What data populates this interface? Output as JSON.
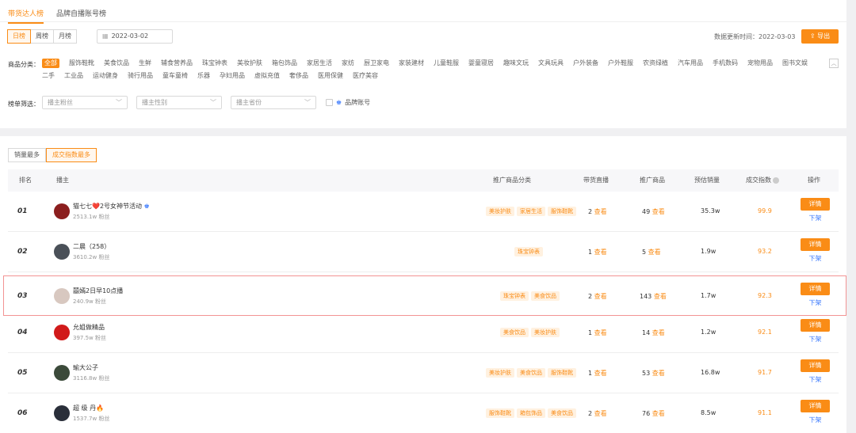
{
  "top_tabs": [
    {
      "label": "带货达人榜",
      "active": true
    },
    {
      "label": "品牌自播账号榜",
      "active": false
    }
  ],
  "period_buttons": [
    {
      "label": "日榜",
      "active": true
    },
    {
      "label": "周榜",
      "active": false
    },
    {
      "label": "月榜",
      "active": false
    }
  ],
  "date_picker": {
    "value": "2022-03-02",
    "icon": "calendar-icon"
  },
  "update_time": "数据更新时间：2022-03-03",
  "export_button": {
    "label": "导出",
    "icon": "upload-icon"
  },
  "categories": {
    "label": "商品分类：",
    "items": [
      "全部",
      "服饰鞋靴",
      "美食饮品",
      "生鲜",
      "辅食营养品",
      "珠宝钟表",
      "美妆护肤",
      "箱包饰品",
      "家居生活",
      "家纺",
      "厨卫家电",
      "家装建材",
      "儿童鞋服",
      "婴童寝居",
      "趣味文玩",
      "文具玩具",
      "户外装备",
      "户外鞋服",
      "农资绿植",
      "汽车用品",
      "手机数码",
      "宠物用品",
      "图书文娱",
      "二手",
      "工业品",
      "运动健身",
      "骑行用品",
      "童车童椅",
      "乐器",
      "孕妇用品",
      "虚拟充值",
      "奢侈品",
      "医用保健",
      "医疗美容"
    ],
    "active_index": 0,
    "toggle_icon": "chevron-up-icon"
  },
  "filters": {
    "label": "榜单筛选：",
    "selects": [
      {
        "placeholder": "播主粉丝"
      },
      {
        "placeholder": "播主性别"
      },
      {
        "placeholder": "播主省份"
      }
    ],
    "brand_checkbox": {
      "label": "品牌账号",
      "checked": false
    }
  },
  "sort_buttons": [
    {
      "label": "销量最多",
      "active": false
    },
    {
      "label": "成交指数最多",
      "active": true
    }
  ],
  "table": {
    "headers": {
      "rank": "排名",
      "host": "播主",
      "categories": "推广商品分类",
      "live": "带货直播",
      "products": "推广商品",
      "sales": "预估销量",
      "index": "成交指数",
      "actions": "操作"
    },
    "view_label": "查看",
    "detail_label": "详情",
    "offshelf_label": "下架",
    "rows": [
      {
        "rank": "01",
        "name": "猫七七❤️2号女神节活动",
        "fans": "2513.1w 粉丝",
        "tags": [
          "美妆护肤",
          "家居生活",
          "服饰鞋靴"
        ],
        "live": "2",
        "products": "49",
        "sales": "35.3w",
        "index": "99.9",
        "avatar_color": "#8b1e1e",
        "verified": true
      },
      {
        "rank": "02",
        "name": "二晨（258）",
        "fans": "3610.2w 粉丝",
        "tags": [
          "珠宝钟表"
        ],
        "live": "1",
        "products": "5",
        "sales": "1.9w",
        "index": "93.2",
        "avatar_color": "#4a5058",
        "verified": false
      },
      {
        "rank": "03",
        "name": "囍嫣2日早10点播",
        "fans": "240.9w 粉丝",
        "tags": [
          "珠宝钟表",
          "美食饮品"
        ],
        "live": "2",
        "products": "143",
        "sales": "1.7w",
        "index": "92.3",
        "avatar_color": "#d8c8c0",
        "verified": false
      },
      {
        "rank": "04",
        "name": "允姐做精品",
        "fans": "397.5w 粉丝",
        "tags": [
          "美食饮品",
          "美妆护肤"
        ],
        "live": "1",
        "products": "14",
        "sales": "1.2w",
        "index": "92.1",
        "avatar_color": "#d11a1a",
        "verified": false
      },
      {
        "rank": "05",
        "name": "瑜大公子",
        "fans": "3116.8w 粉丝",
        "tags": [
          "美妆护肤",
          "美食饮品",
          "服饰鞋靴"
        ],
        "live": "1",
        "products": "53",
        "sales": "16.8w",
        "index": "91.7",
        "avatar_color": "#3b4a3a",
        "verified": false
      },
      {
        "rank": "06",
        "name": "超 级 丹🔥",
        "fans": "1537.7w 粉丝",
        "tags": [
          "服饰鞋靴",
          "箱包饰品",
          "美食饮品"
        ],
        "live": "2",
        "products": "76",
        "sales": "8.5w",
        "index": "91.1",
        "avatar_color": "#2a2f3a",
        "verified": false
      }
    ]
  },
  "colors": {
    "accent": "#fa8c16",
    "link": "#3d7bfd"
  }
}
